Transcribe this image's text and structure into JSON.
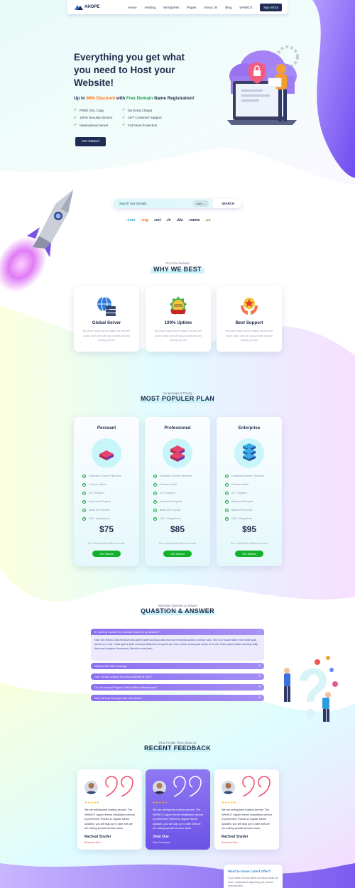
{
  "nav": {
    "brand": "AHOPE",
    "items": [
      "Home",
      "Hosting",
      "Wordpress",
      "Pages",
      "About Us",
      "Blog",
      "WHMCS"
    ],
    "signin": "Sign in/Out"
  },
  "hero": {
    "title": "Everything you get what you need to Host your Website!",
    "discount_prefix": "Up to ",
    "discount_value": "90% Discount",
    "discount_mid": " with ",
    "discount_free": "Free Domain",
    "discount_suffix": " Name Registration!",
    "features": [
      "FREE SSL Copy",
      "No Extra Charge",
      "100% Security Service",
      "24/7 Customer Support",
      "International Server",
      "Full Virus Protection"
    ],
    "cta": "Get Started"
  },
  "domain_search": {
    "placeholder": "Search Your Domain",
    "tld_select": ".com",
    "button": "SEARCH",
    "tlds": [
      ".com",
      ".org",
      ".net",
      ".tv",
      ".biz",
      ".name",
      ".cc"
    ]
  },
  "why": {
    "subtitle": "Our Core features",
    "title": "WHY WE BEST",
    "cards": [
      {
        "title": "Global Server",
        "desc": "We have many server station all over the world, thats why we can provide smooth hosting service"
      },
      {
        "title": "100% Uptime",
        "desc": "We have many server station all over the world, thats why we can provide smooth hosting service"
      },
      {
        "title": "Best Support",
        "desc": "We have many server station all over the world, thats why we can provide smooth hosting service"
      }
    ]
  },
  "pricing": {
    "subtitle": "our package & Pricing",
    "title": "MOST POPULER PLAN",
    "features": [
      "Unlimited Shared Pipelines",
      "Custom Views",
      "24/7 Support",
      "Advanced Reports",
      "Basic API Access",
      "100+ Integrations"
    ],
    "period": "Per User/Month Billed Annually",
    "cta": "Get Started",
    "plans": [
      {
        "name": "Persoanl",
        "price": "$75"
      },
      {
        "name": "Professional",
        "price": "$85"
      },
      {
        "name": "Enterprise",
        "price": "$95"
      }
    ]
  },
  "faq": {
    "subtitle": "Important Question & Answer",
    "title": "QUASTION & ANSWER",
    "open_question": "If i want to transfer my domain what the procedure?",
    "open_answer": "Nam nec tellus a odio tincidunt taa aptent taciti sociosqu adlip litora per inceptos auctor a ornare odio. Sed non mauris vitae erat conse quat auctor eu in elit. Class aptent taciti sociosqu adlip litora torquent per ubia nostra, consequat auctor eu in elit. Class aptent taciti sociosqu adlip litora per inceptos himenaeos, Mauris in erat justo.",
    "questions": [
      "What is the SSD Hosting?",
      "Can I Know, what is the actual Benifit of SSL?",
      "Do You Accept Paypal Dollar Without Mastercard?",
      "Why we buy form you and not others?"
    ]
  },
  "feedback": {
    "subtitle": "What People Think About Us",
    "title": "RECENT FEEDBACK",
    "items": [
      {
        "stars": "★★★★★",
        "quote": "We are selling best hosting service. The WHMCS Lagom theme installation service is performed Thanks to regular theme updates, you will stay up to date with we are selling special domain name.",
        "name": "Racheal Snyder",
        "role": "Business Man"
      },
      {
        "stars": "★★★★★",
        "quote": "We are selling best hosting service. The WHMCS Lagom theme installation service is performed Thanks to regular theme updates, you will stay up to date with we are selling special domain name.",
        "name": "Jhon Doe",
        "role": "Web Developer"
      },
      {
        "stars": "★★★★★",
        "quote": "We are selling best hosting service. The WHMCS Lagom theme installation service is performed Thanks to regular theme updates, you will stay up to date with we are selling special domain name.",
        "name": "Racheal Snyder",
        "role": "Business Man"
      }
    ]
  },
  "offer": {
    "title": "Want to Know Latest Offer?",
    "desc": "If you want to know latest cut ipsum dolor sit amet, consectetur adipiscing elit, sed do eiusmod tem"
  },
  "colors": {
    "navy": "#1f2d55",
    "accent_orange": "#f97316",
    "accent_green": "#16a34a",
    "purple": "#7c5cf0",
    "button_green": "#12b12b"
  }
}
